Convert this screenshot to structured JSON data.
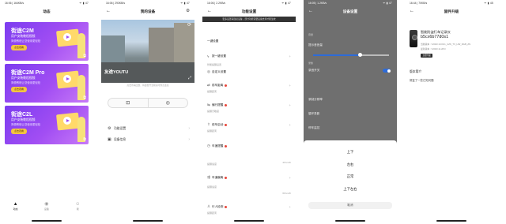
{
  "screens": {
    "s1": {
      "status_left": "16:06 | 164KB/s",
      "status_right": "ᯤ ▮ 47",
      "title": "动态",
      "banners": [
        {
          "model": "街途C2M",
          "line1": "用户安装教程视频",
          "line2": "简便教程让您使用更轻松",
          "button": "点击观看"
        },
        {
          "model": "街途C2M Pro",
          "line1": "用户安装教程视频",
          "line2": "简便教程让您使用更轻松",
          "button": "点击观看"
        },
        {
          "model": "街途C2L",
          "line1": "用户安装教程视频",
          "line2": "简便教程让您使用更轻松",
          "button": "点击观看"
        }
      ],
      "nav": [
        "动态",
        "设备",
        "我"
      ]
    },
    "s2": {
      "status_left": "16:06 | 293KB/s",
      "status_right": "ᯤ ▮ 47",
      "title": "我的设备",
      "watermark": "友途YOUTU",
      "hint": "点击查看回放，将会断开当前实时预览连接",
      "menu": [
        "功能设置",
        "设备信息"
      ]
    },
    "s3": {
      "status_left": "16:06 | 2.2KB/s",
      "status_right": "ᯤ ▮ 47",
      "title": "功能设置",
      "info": "更多设置请连接设备，部分功能需要设备支持才能生效",
      "row1": "一键设置",
      "row2": "按一键设置",
      "section": "智能提醒设置",
      "row3": "自定义设置",
      "items": [
        {
          "label": "前车距离",
          "sub": "提醒距离",
          "val": ""
        },
        {
          "label": "偏行提醒",
          "sub": "提醒灵敏度",
          "val": ""
        },
        {
          "label": "前车启动",
          "sub": "提醒距离",
          "val": ""
        },
        {
          "label": "车速提醒",
          "sub": "提醒速度",
          "val": "40 km/h"
        },
        {
          "label": "车道偏离",
          "sub": "提醒速度",
          "val": "60 km/h"
        },
        {
          "label": "行人检测",
          "sub": "提醒距离",
          "val": ""
        }
      ]
    },
    "s4": {
      "status_left": "16:05 | 1.2KB/s",
      "status_right": "ᯤ ▮ 47",
      "title": "设备设置",
      "sec1": "音量",
      "volume_label": "提示音音量",
      "volume_level": 0.62,
      "sec2": "录像",
      "toggle_label": "录音开关",
      "list": [
        "录制分辨率",
        "循环录影",
        "停车监控",
        "屏幕常亮"
      ],
      "options": [
        "上下",
        "左右",
        "正常",
        "上下左右"
      ],
      "cancel": "取消"
    },
    "s5": {
      "status_left": "16:44 | 70KB/s",
      "status_right": "ᯤ ▮ 45",
      "title": "固件升级",
      "device_name": "智能防盗行车记录仪",
      "device_id": "b5cx6b77d0s1",
      "ver1": "当前版本 : V2023.10.09.1_CZK_TX_HW_RGB_ZN",
      "ver2": "最新版本 : V2023.11.28.0",
      "upgrade_btn": "立即升级",
      "notes_title": "版本简介",
      "notes_text": "修复了一些已知问题"
    }
  },
  "colors": {
    "banner_accent": "#a24ef3",
    "button_yellow": "#f4c542",
    "alert_red": "#e8473b",
    "switch_blue": "#2d6bd9"
  }
}
